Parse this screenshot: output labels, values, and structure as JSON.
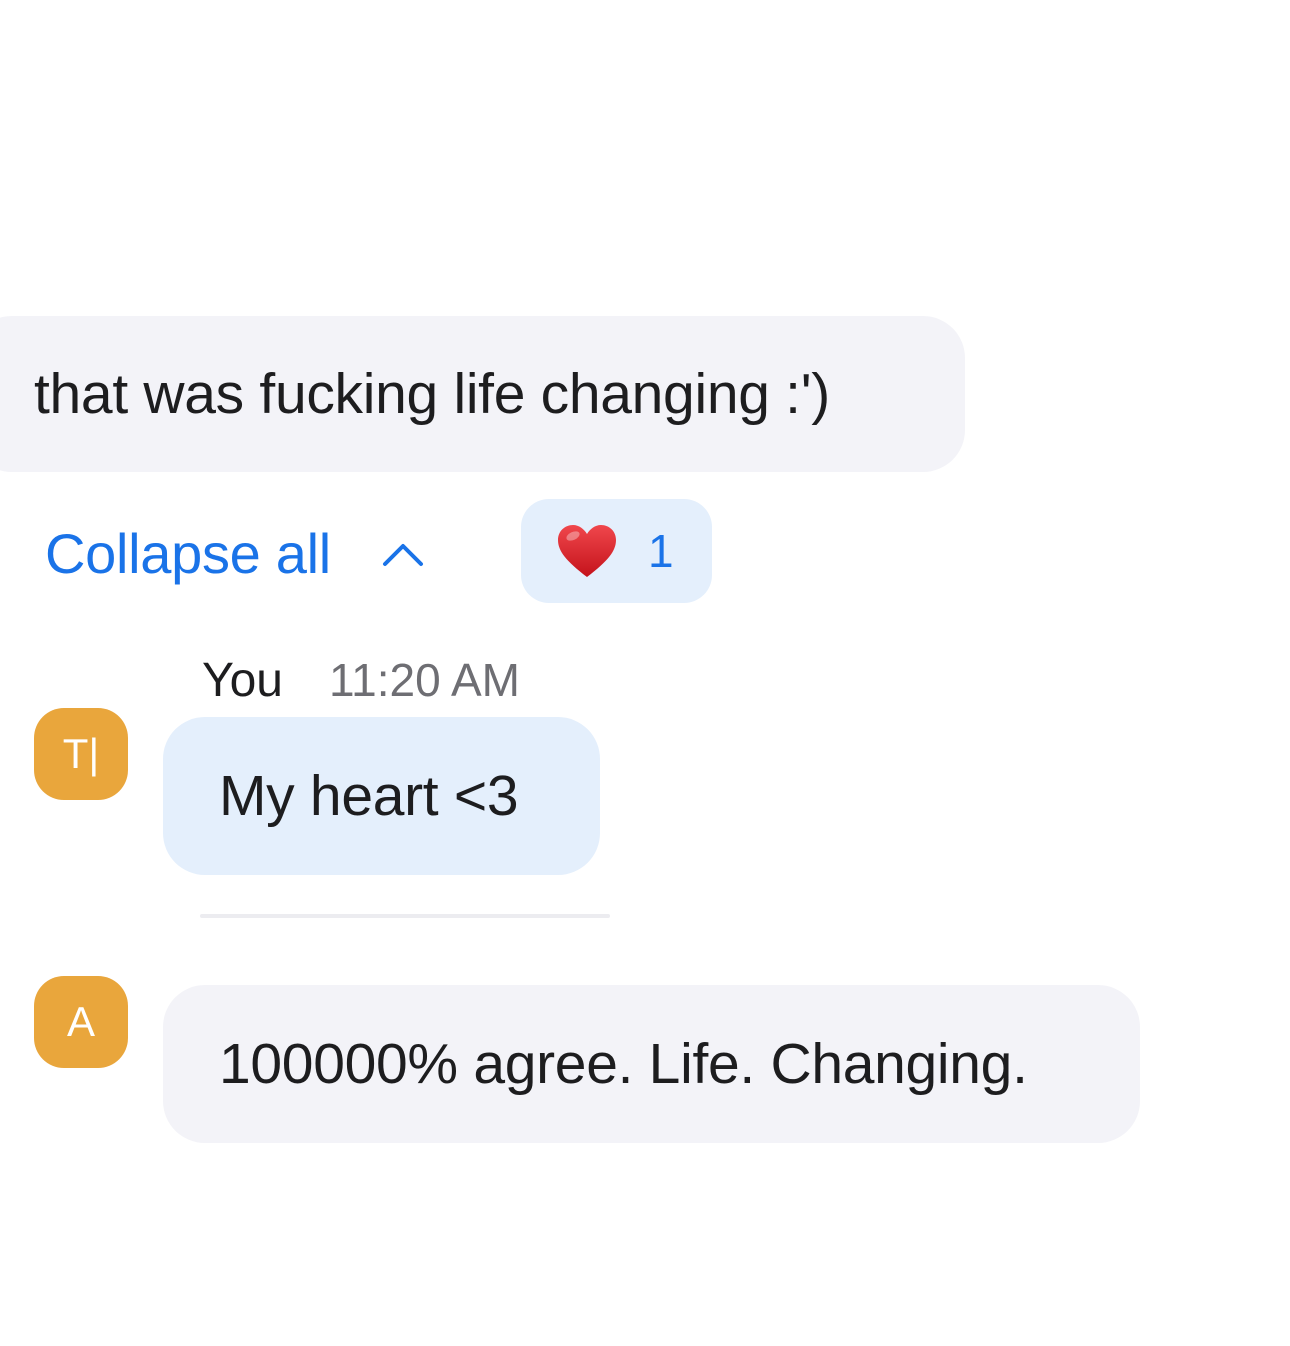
{
  "messages": [
    {
      "id": "msg1",
      "text": "that was fucking life changing :')",
      "direction": "incoming"
    },
    {
      "id": "msg3",
      "sender": "You",
      "time": "11:20 AM",
      "avatar_initials": "T|",
      "text": "My heart <3",
      "direction": "outgoing"
    },
    {
      "id": "msg4",
      "avatar_initials": "A",
      "text": "100000% agree. Life. Changing.",
      "direction": "incoming"
    }
  ],
  "thread": {
    "collapse_label": "Collapse all",
    "collapse_icon": "chevron-up-icon"
  },
  "reaction": {
    "emoji_icon": "red-heart-icon",
    "count": "1"
  },
  "colors": {
    "incoming_bubble": "#f3f3f8",
    "outgoing_bubble": "#e4effc",
    "link_blue": "#1a73e8",
    "avatar_orange": "#e9a63c",
    "timestamp_gray": "#6e6e73"
  }
}
